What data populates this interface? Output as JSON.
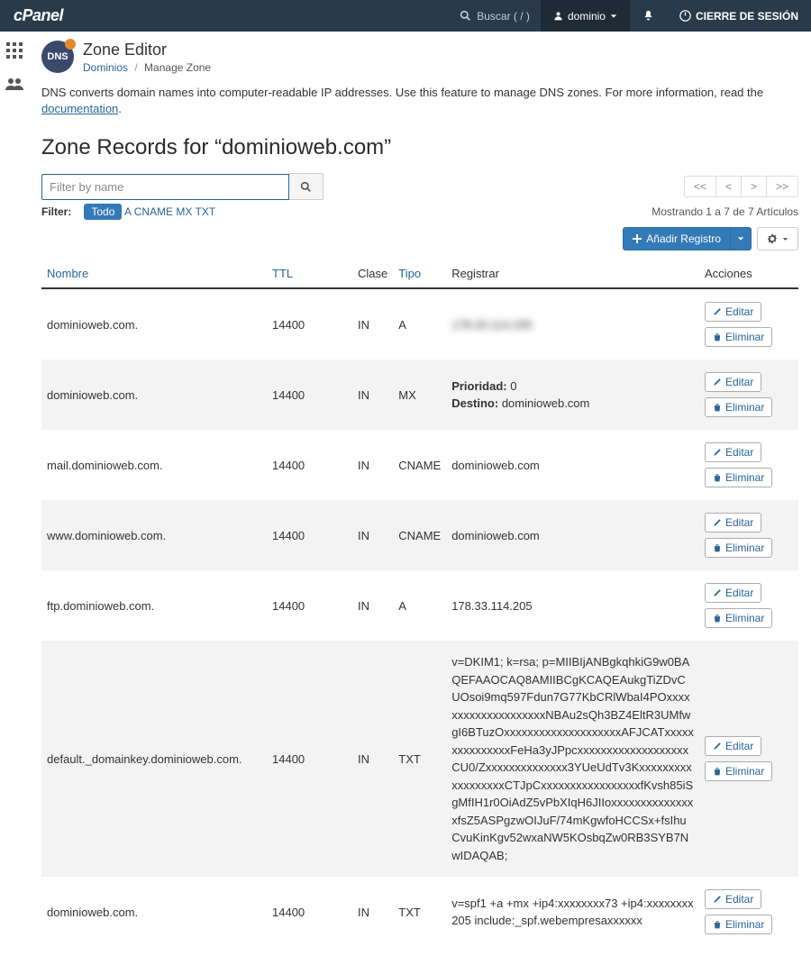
{
  "topbar": {
    "logo": "cPanel",
    "search_label": "Buscar ( / )",
    "user": "dominio",
    "logout": "CIERRE DE SESIÓN"
  },
  "page": {
    "badge": "DNS",
    "title": "Zone Editor",
    "breadcrumb_link": "Dominios",
    "breadcrumb_current": "Manage Zone",
    "intro_prefix": "DNS converts domain names into computer-readable IP addresses. Use this feature to manage DNS zones. For more information, read the ",
    "intro_link": "documentation",
    "zone_title": "Zone Records for “dominioweb.com”"
  },
  "filter": {
    "placeholder": "Filter by name",
    "label": "Filter:",
    "tags": [
      "Todo",
      "A",
      "CNAME",
      "MX",
      "TXT"
    ],
    "active_tag": "Todo"
  },
  "pager": {
    "first": "<<",
    "prev": "<",
    "next": ">",
    "last": ">>"
  },
  "showing": "Mostrando 1 a 7 de 7 Artículos",
  "addbtn": "Añadir Registro",
  "columns": {
    "name": "Nombre",
    "ttl": "TTL",
    "class": "Clase",
    "type": "Tipo",
    "register": "Registrar",
    "actions": "Acciones"
  },
  "actions": {
    "edit": "Editar",
    "delete": "Eliminar"
  },
  "mx": {
    "priority_label": "Prioridad:",
    "priority_value": "0",
    "dest_label": "Destino:",
    "dest_value": "dominioweb.com"
  },
  "rows": [
    {
      "name": "dominioweb.com.",
      "ttl": "14400",
      "class": "IN",
      "type": "A",
      "value": "178.33.114.205",
      "blur_value": true
    },
    {
      "name": "dominioweb.com.",
      "ttl": "14400",
      "class": "IN",
      "type": "MX",
      "mx": true
    },
    {
      "name": "mail.dominioweb.com.",
      "ttl": "14400",
      "class": "IN",
      "type": "CNAME",
      "value": "dominioweb.com"
    },
    {
      "name": "www.dominioweb.com.",
      "ttl": "14400",
      "class": "IN",
      "type": "CNAME",
      "value": "dominioweb.com"
    },
    {
      "name": "ftp.dominioweb.com.",
      "ttl": "14400",
      "class": "IN",
      "type": "A",
      "value": "178.33.114.205"
    },
    {
      "name": "default._domainkey.dominioweb.com.",
      "ttl": "14400",
      "class": "IN",
      "type": "TXT",
      "value": "v=DKIM1; k=rsa; p=MIIBIjANBgkqhkiG9w0BAQEFAAOCAQ8AMIIBCgKCAQEAukgTiZDvCUOsoi9mq597Fdun7G77KbCRlWbaI4POxxxxxxxxxxxxxxxxxxxxNBAu2sQh3BZ4EltR3UMfwgI6BTuzOxxxxxxxxxxxxxxxxxxxxAFJCATxxxxxxxxxxxxxxxFeHa3yJPpcxxxxxxxxxxxxxxxxxxxCU0/Zxxxxxxxxxxxxxx3YUeUdTv3KxxxxxxxxxxxxxxxxxxCTJpCxxxxxxxxxxxxxxxxxfKvsh85iSgMfIH1r0OiAdZ5vPbXIqH6JIIoxxxxxxxxxxxxxxxfsZ5ASPgzwOIJuF/74mKgwfoHCCSx+fsIhuCvuKinKgv52wxaNW5KOsbqZw0RB3SYB7NwIDAQAB;"
    },
    {
      "name": "dominioweb.com.",
      "ttl": "14400",
      "class": "IN",
      "type": "TXT",
      "value": "v=spf1 +a +mx +ip4:xxxxxxxx73 +ip4:xxxxxxxx205 include:_spf.webempresaxxxxxx"
    }
  ]
}
